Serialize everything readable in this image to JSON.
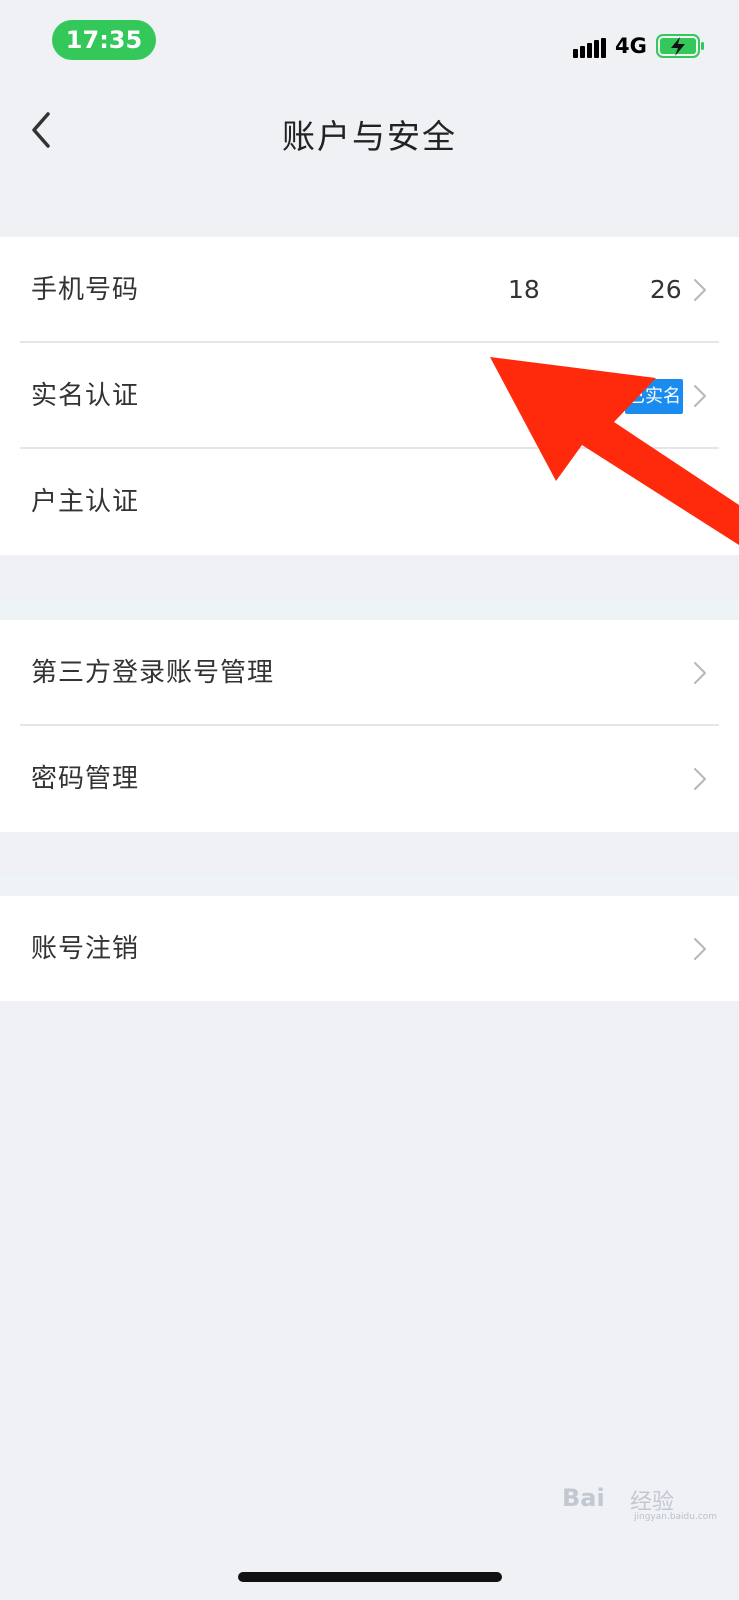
{
  "status_bar": {
    "time": "17:35",
    "network": "4G",
    "icons": [
      "signal-icon",
      "battery-charging-icon"
    ],
    "time_pill_color": "#34c759",
    "battery_color": "#34c759"
  },
  "nav": {
    "title": "账户与安全",
    "back_icon": "chevron-left-icon"
  },
  "groups": [
    {
      "rows": [
        {
          "label": "手机号码",
          "value_start": "18",
          "value_end": "26"
        },
        {
          "label": "实名认证",
          "badge": "已实名"
        },
        {
          "label": "户主认证"
        }
      ]
    },
    {
      "rows": [
        {
          "label": "第三方登录账号管理"
        },
        {
          "label": "密码管理"
        }
      ]
    },
    {
      "rows": [
        {
          "label": "账号注销"
        }
      ]
    }
  ],
  "colors": {
    "background": "#eff1f4",
    "badge": "#1a8cf0",
    "annotation_arrow": "#ff2a0c"
  },
  "watermark": {
    "brand": "Bai",
    "cn": "经验",
    "url": "jingyan.baidu.com"
  }
}
